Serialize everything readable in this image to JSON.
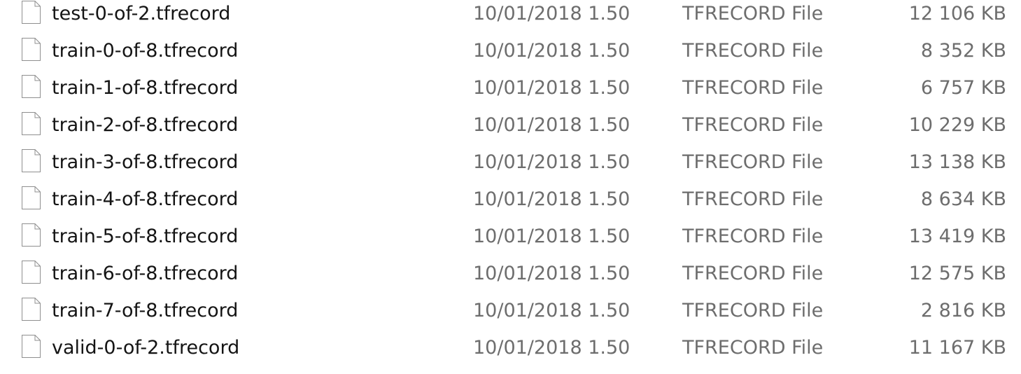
{
  "files": [
    {
      "name": "test-0-of-2.tfrecord",
      "date": "10/01/2018 1.50",
      "type": "TFRECORD File",
      "size": "12 106 KB"
    },
    {
      "name": "train-0-of-8.tfrecord",
      "date": "10/01/2018 1.50",
      "type": "TFRECORD File",
      "size": "8 352 KB"
    },
    {
      "name": "train-1-of-8.tfrecord",
      "date": "10/01/2018 1.50",
      "type": "TFRECORD File",
      "size": "6 757 KB"
    },
    {
      "name": "train-2-of-8.tfrecord",
      "date": "10/01/2018 1.50",
      "type": "TFRECORD File",
      "size": "10 229 KB"
    },
    {
      "name": "train-3-of-8.tfrecord",
      "date": "10/01/2018 1.50",
      "type": "TFRECORD File",
      "size": "13 138 KB"
    },
    {
      "name": "train-4-of-8.tfrecord",
      "date": "10/01/2018 1.50",
      "type": "TFRECORD File",
      "size": "8 634 KB"
    },
    {
      "name": "train-5-of-8.tfrecord",
      "date": "10/01/2018 1.50",
      "type": "TFRECORD File",
      "size": "13 419 KB"
    },
    {
      "name": "train-6-of-8.tfrecord",
      "date": "10/01/2018 1.50",
      "type": "TFRECORD File",
      "size": "12 575 KB"
    },
    {
      "name": "train-7-of-8.tfrecord",
      "date": "10/01/2018 1.50",
      "type": "TFRECORD File",
      "size": "2 816 KB"
    },
    {
      "name": "valid-0-of-2.tfrecord",
      "date": "10/01/2018 1.50",
      "type": "TFRECORD File",
      "size": "11 167 KB"
    }
  ],
  "icons": {
    "file": "blank-document-icon"
  },
  "colors": {
    "name_text": "#141414",
    "detail_text": "#6d6d6d",
    "background": "#ffffff"
  }
}
